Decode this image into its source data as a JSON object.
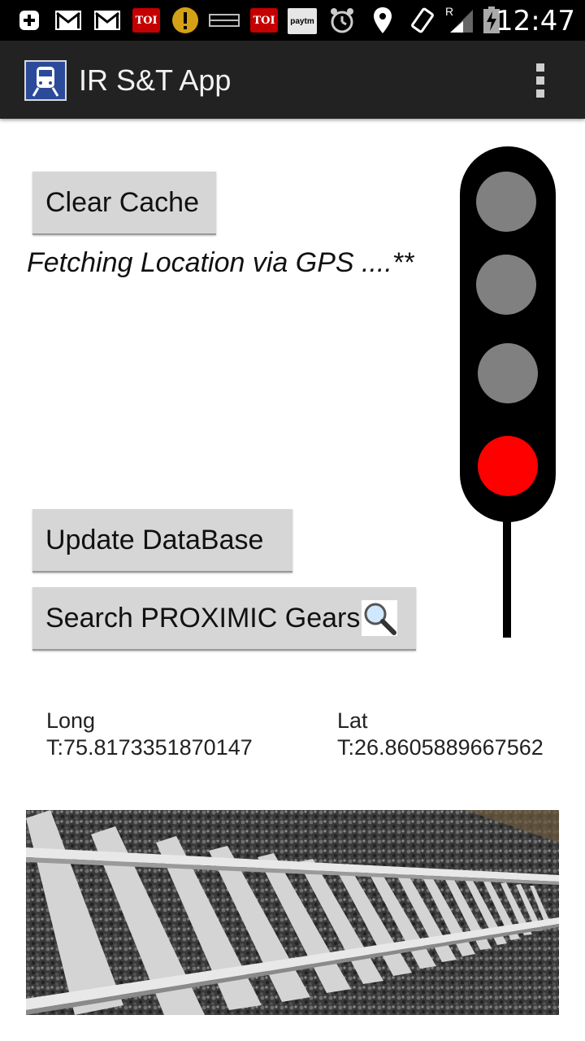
{
  "status_bar": {
    "time": "12:47",
    "icons": [
      "add-icon",
      "gmail-icon",
      "gmail-icon",
      "toi-icon",
      "warning-icon",
      "mail-icon",
      "toi-icon",
      "paytm-icon",
      "alarm-icon",
      "location-icon",
      "rotate-icon",
      "signal-icon",
      "battery-icon"
    ],
    "toi_label": "TOI",
    "paytm_label": "paytm",
    "roaming_label": "R"
  },
  "action_bar": {
    "title": "IR S&T App"
  },
  "buttons": {
    "clear_cache": "Clear Cache",
    "update_database": "Update DataBase",
    "search_gears": "Search PROXIMIC Gears"
  },
  "status_message": "Fetching Location via GPS ....**",
  "coordinates": {
    "long_label": "Long",
    "long_value": "T:75.8173351870147",
    "lat_label": "Lat",
    "lat_value": "T:26.8605889667562"
  },
  "signal": {
    "aspects": [
      "off",
      "off",
      "off",
      "red"
    ],
    "colors": {
      "off": "#808080",
      "red": "#ff0000",
      "body": "#000000"
    }
  }
}
